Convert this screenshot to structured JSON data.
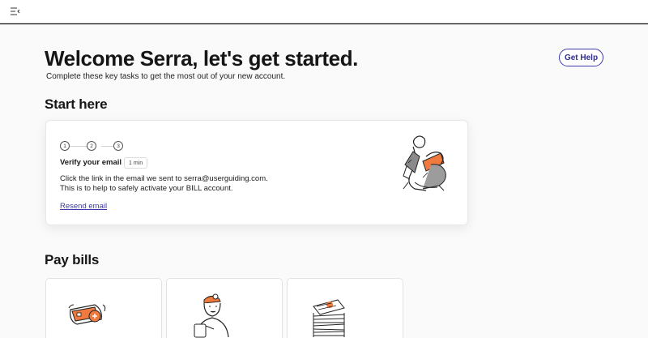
{
  "header": {
    "menu_icon": "sidebar-collapse-icon"
  },
  "page": {
    "title": "Welcome Serra, let's get started.",
    "subtitle": "Complete these key tasks to get the most out of your new account.",
    "help_button": "Get Help"
  },
  "start_here": {
    "heading": "Start here",
    "steps": [
      "1",
      "2",
      "3"
    ],
    "active_step": 1,
    "task": {
      "title": "Verify your email",
      "duration": "1 min",
      "description_line1": "Click the link in the email we sent to serra@userguiding.com.",
      "description_line2": "This is to help to safely activate your BILL account.",
      "link": "Resend email"
    },
    "illustration": "person-reading-illustration"
  },
  "pay_bills": {
    "heading": "Pay bills",
    "cards": [
      {
        "illustration": "credit-card-icon"
      },
      {
        "illustration": "delivery-person-icon"
      },
      {
        "illustration": "paper-stack-icon"
      }
    ]
  },
  "colors": {
    "accent": "#3b3aa6",
    "illustration_orange": "#f07a3e",
    "page_bg": "#fafafa"
  }
}
